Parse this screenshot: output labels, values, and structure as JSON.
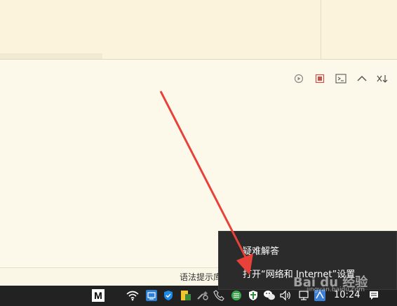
{
  "context_menu": {
    "items": [
      {
        "label": "疑难解答"
      },
      {
        "label": "打开“网络和 Internet”设置"
      }
    ]
  },
  "status_bar": {
    "hint_text": "语法提示库"
  },
  "taskbar": {
    "clock": "10:24",
    "m_icon_label": "M"
  },
  "watermark": {
    "main": "Bai du 经验",
    "sub": "jingyan.baidu.com"
  },
  "toolbar": {
    "icons": [
      "run-icon",
      "stop-icon",
      "terminal-icon",
      "chevron-up-icon",
      "sort-down-icon"
    ]
  },
  "colors": {
    "arrow": "#e8413a",
    "background": "#fdf9ea",
    "taskbar": "#222222",
    "menu": "#2b2b2b"
  }
}
